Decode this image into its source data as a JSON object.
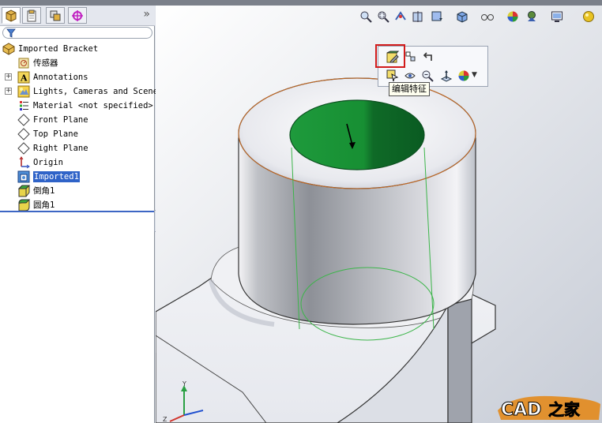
{
  "feature_tree": {
    "items": [
      {
        "label": "Imported Bracket",
        "icon": "part-icon",
        "expander": ""
      },
      {
        "label": "传感器",
        "icon": "sensor-icon",
        "expander": ""
      },
      {
        "label": "Annotations",
        "icon": "annotations-icon",
        "expander": "+"
      },
      {
        "label": "Lights, Cameras and Scene",
        "icon": "lights-icon",
        "expander": "+"
      },
      {
        "label": "Material <not specified>",
        "icon": "material-icon",
        "expander": ""
      },
      {
        "label": "Front Plane",
        "icon": "plane-icon",
        "expander": ""
      },
      {
        "label": "Top Plane",
        "icon": "plane-icon",
        "expander": ""
      },
      {
        "label": "Right Plane",
        "icon": "plane-icon",
        "expander": ""
      },
      {
        "label": "Origin",
        "icon": "origin-icon",
        "expander": ""
      },
      {
        "label": "Imported1",
        "icon": "imported-feature-icon",
        "expander": "",
        "selected": true
      },
      {
        "label": "倒角1",
        "icon": "chamfer-icon",
        "expander": ""
      },
      {
        "label": "圆角1",
        "icon": "fillet-icon",
        "expander": ""
      }
    ],
    "collapse_glyph": "»"
  },
  "panel_tabs": [
    "featuremanager-tab-icon",
    "propertymanager-tab-icon",
    "configurationmanager-tab-icon",
    "dimxpert-tab-icon"
  ],
  "view_toolbar": [
    "zoom-to-fit-icon",
    "zoom-to-area-icon",
    "previous-view-icon",
    "section-view-icon",
    "view-orientation-icon",
    "display-style-icon",
    "hide-show-items-icon",
    "edit-appearance-icon",
    "apply-scene-icon",
    "view-settings-icon",
    "realview-icon"
  ],
  "context_toolbar": {
    "row1": [
      "edit-feature-icon",
      "edit-sketch-icon",
      "rollback-icon"
    ],
    "row2": [
      "select-other-icon",
      "hide-icon",
      "zoom-to-selection-icon",
      "normal-to-icon",
      "appearance-icon"
    ],
    "tooltip": "编辑特征"
  },
  "colors": {
    "selection": "#2f63c8",
    "highlight_box": "#d21b1b",
    "face_green": "#1f9a3a"
  }
}
